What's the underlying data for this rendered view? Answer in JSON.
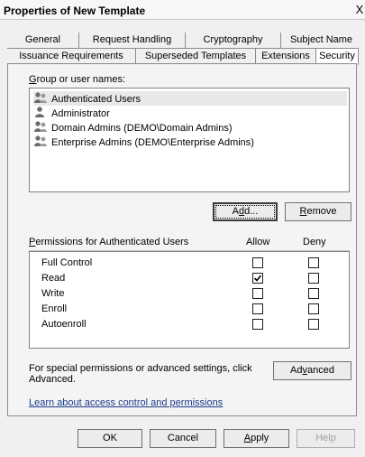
{
  "window": {
    "title": "Properties of New Template",
    "close_glyph": "X"
  },
  "tabs": {
    "row1": [
      "General",
      "Request Handling",
      "Cryptography",
      "Subject Name"
    ],
    "row2": [
      "Issuance Requirements",
      "Superseded Templates",
      "Extensions",
      "Security"
    ],
    "active": "Security"
  },
  "group_list": {
    "label_prefix": "",
    "label_underline": "G",
    "label_rest": "roup or user names:",
    "items": [
      {
        "name": "Authenticated Users",
        "icon": "users-group-icon",
        "selected": true
      },
      {
        "name": "Administrator",
        "icon": "user-icon",
        "selected": false
      },
      {
        "name": "Domain Admins (DEMO\\Domain Admins)",
        "icon": "users-group-icon",
        "selected": false
      },
      {
        "name": "Enterprise Admins (DEMO\\Enterprise Admins)",
        "icon": "users-group-icon",
        "selected": false
      }
    ]
  },
  "buttons": {
    "add_pre": "A",
    "add_ul": "d",
    "add_post": "d...",
    "remove_ul": "R",
    "remove_post": "emove",
    "advanced_pre": "Ad",
    "advanced_ul": "v",
    "advanced_post": "anced",
    "ok": "OK",
    "cancel": "Cancel",
    "apply_ul": "A",
    "apply_post": "pply",
    "help": "Help"
  },
  "permissions": {
    "header_ul": "P",
    "header_rest": "ermissions for Authenticated Users",
    "allow_label": "Allow",
    "deny_label": "Deny",
    "rows": [
      {
        "name": "Full Control",
        "allow": false,
        "deny": false
      },
      {
        "name": "Read",
        "allow": true,
        "deny": false
      },
      {
        "name": "Write",
        "allow": false,
        "deny": false
      },
      {
        "name": "Enroll",
        "allow": false,
        "deny": false
      },
      {
        "name": "Autoenroll",
        "allow": false,
        "deny": false
      }
    ]
  },
  "special_text_line1": "For special permissions or advanced settings, click",
  "special_text_line2": "Advanced.",
  "learn_link": "Learn about access control and permissions"
}
